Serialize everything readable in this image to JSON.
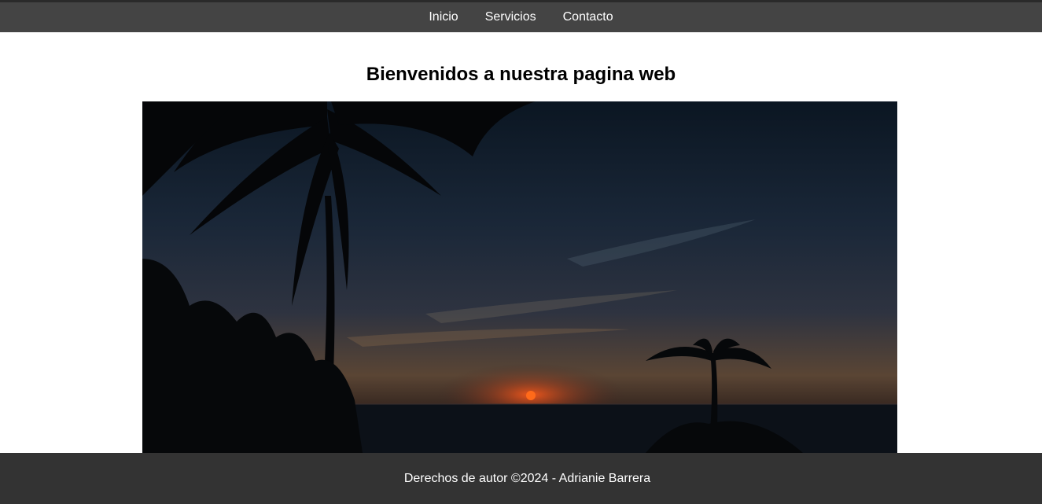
{
  "nav": {
    "items": [
      {
        "label": "Inicio"
      },
      {
        "label": "Servicios"
      },
      {
        "label": "Contacto"
      }
    ]
  },
  "main": {
    "title": "Bienvenidos a nuestra pagina web",
    "hero_image": {
      "subject": "sunset-palm-silhouette"
    }
  },
  "footer": {
    "text": "Derechos de autor ©2024 - Adrianie Barrera"
  },
  "colors": {
    "nav_bg": "#444444",
    "footer_bg": "#333333",
    "text_light": "#ffffff",
    "title": "#000000"
  }
}
